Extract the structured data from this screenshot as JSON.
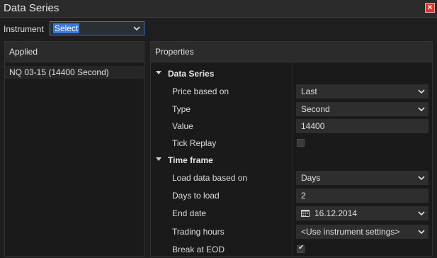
{
  "window": {
    "title": "Data Series"
  },
  "instrument": {
    "label": "Instrument",
    "value": "Select"
  },
  "applied": {
    "header": "Applied",
    "items": [
      "NQ 03-15 (14400 Second)"
    ]
  },
  "properties": {
    "header": "Properties",
    "sections": [
      {
        "title": "Data Series",
        "rows": [
          {
            "label": "Price based on",
            "value": "Last",
            "kind": "dropdown"
          },
          {
            "label": "Type",
            "value": "Second",
            "kind": "dropdown"
          },
          {
            "label": "Value",
            "value": "14400",
            "kind": "text"
          },
          {
            "label": "Tick Replay",
            "checked": false,
            "kind": "checkbox"
          }
        ]
      },
      {
        "title": "Time frame",
        "rows": [
          {
            "label": "Load data based on",
            "value": "Days",
            "kind": "dropdown"
          },
          {
            "label": "Days to load",
            "value": "2",
            "kind": "text"
          },
          {
            "label": "End date",
            "value": "16.12.2014",
            "kind": "date"
          },
          {
            "label": "Trading hours",
            "value": "<Use instrument settings>",
            "kind": "dropdown"
          },
          {
            "label": "Break at EOD",
            "checked": true,
            "kind": "checkbox"
          }
        ]
      }
    ]
  },
  "icons": {
    "close": "close-icon",
    "dropdown": "chevron-down-icon",
    "calendar": "calendar-icon",
    "collapse": "triangle-down-icon"
  },
  "colors": {
    "background": "#1e1e1e",
    "accent": "#3b78d8",
    "close": "#d9392b"
  }
}
